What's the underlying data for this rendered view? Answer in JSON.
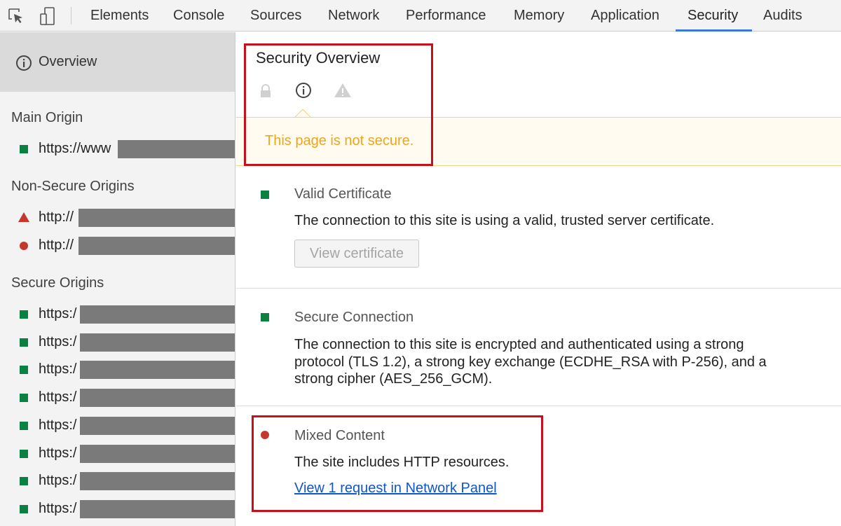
{
  "toolbar": {
    "inspect_icon": "inspect-element-icon",
    "device_icon": "device-toolbar-icon",
    "tabs": [
      {
        "label": "Elements"
      },
      {
        "label": "Console"
      },
      {
        "label": "Sources"
      },
      {
        "label": "Network"
      },
      {
        "label": "Performance"
      },
      {
        "label": "Memory"
      },
      {
        "label": "Application"
      },
      {
        "label": "Security",
        "active": true
      },
      {
        "label": "Audits"
      }
    ],
    "accent_color": "#3879d9"
  },
  "sidebar": {
    "overview_label": "Overview",
    "main_origin": {
      "header": "Main Origin",
      "items": [
        {
          "text": "https://www",
          "status": "secure"
        }
      ]
    },
    "non_secure_origins": {
      "header": "Non-Secure Origins",
      "items": [
        {
          "text": "http://",
          "status": "warning-triangle"
        },
        {
          "text": "http://",
          "status": "insecure-dot"
        }
      ]
    },
    "secure_origins": {
      "header": "Secure Origins",
      "items": [
        {
          "text": "https:/"
        },
        {
          "text": "https:/"
        },
        {
          "text": "https:/"
        },
        {
          "text": "https:/"
        },
        {
          "text": "https:/"
        },
        {
          "text": "https:/"
        },
        {
          "text": "https:/"
        },
        {
          "text": "https:/"
        }
      ]
    }
  },
  "overview": {
    "title": "Security Overview",
    "status_icons": [
      "lock-icon",
      "info-icon",
      "warning-icon"
    ],
    "banner_text": "This page is not secure.",
    "banner_color": "#f0a519"
  },
  "sections": {
    "certificate": {
      "title": "Valid Certificate",
      "description": "The connection to this site is using a valid, trusted server certificate.",
      "button_label": "View certificate"
    },
    "connection": {
      "title": "Secure Connection",
      "description": "The connection to this site is encrypted and authenticated using a strong protocol (TLS 1.2), a strong key exchange (ECDHE_RSA with P-256), and a strong cipher (AES_256_GCM)."
    },
    "mixed_content": {
      "title": "Mixed Content",
      "description": "The site includes HTTP resources.",
      "link_text": "View 1 request in Network Panel"
    }
  },
  "colors": {
    "secure": "#0b8043",
    "insecure": "#c5372c",
    "highlight": "#c8101a"
  }
}
